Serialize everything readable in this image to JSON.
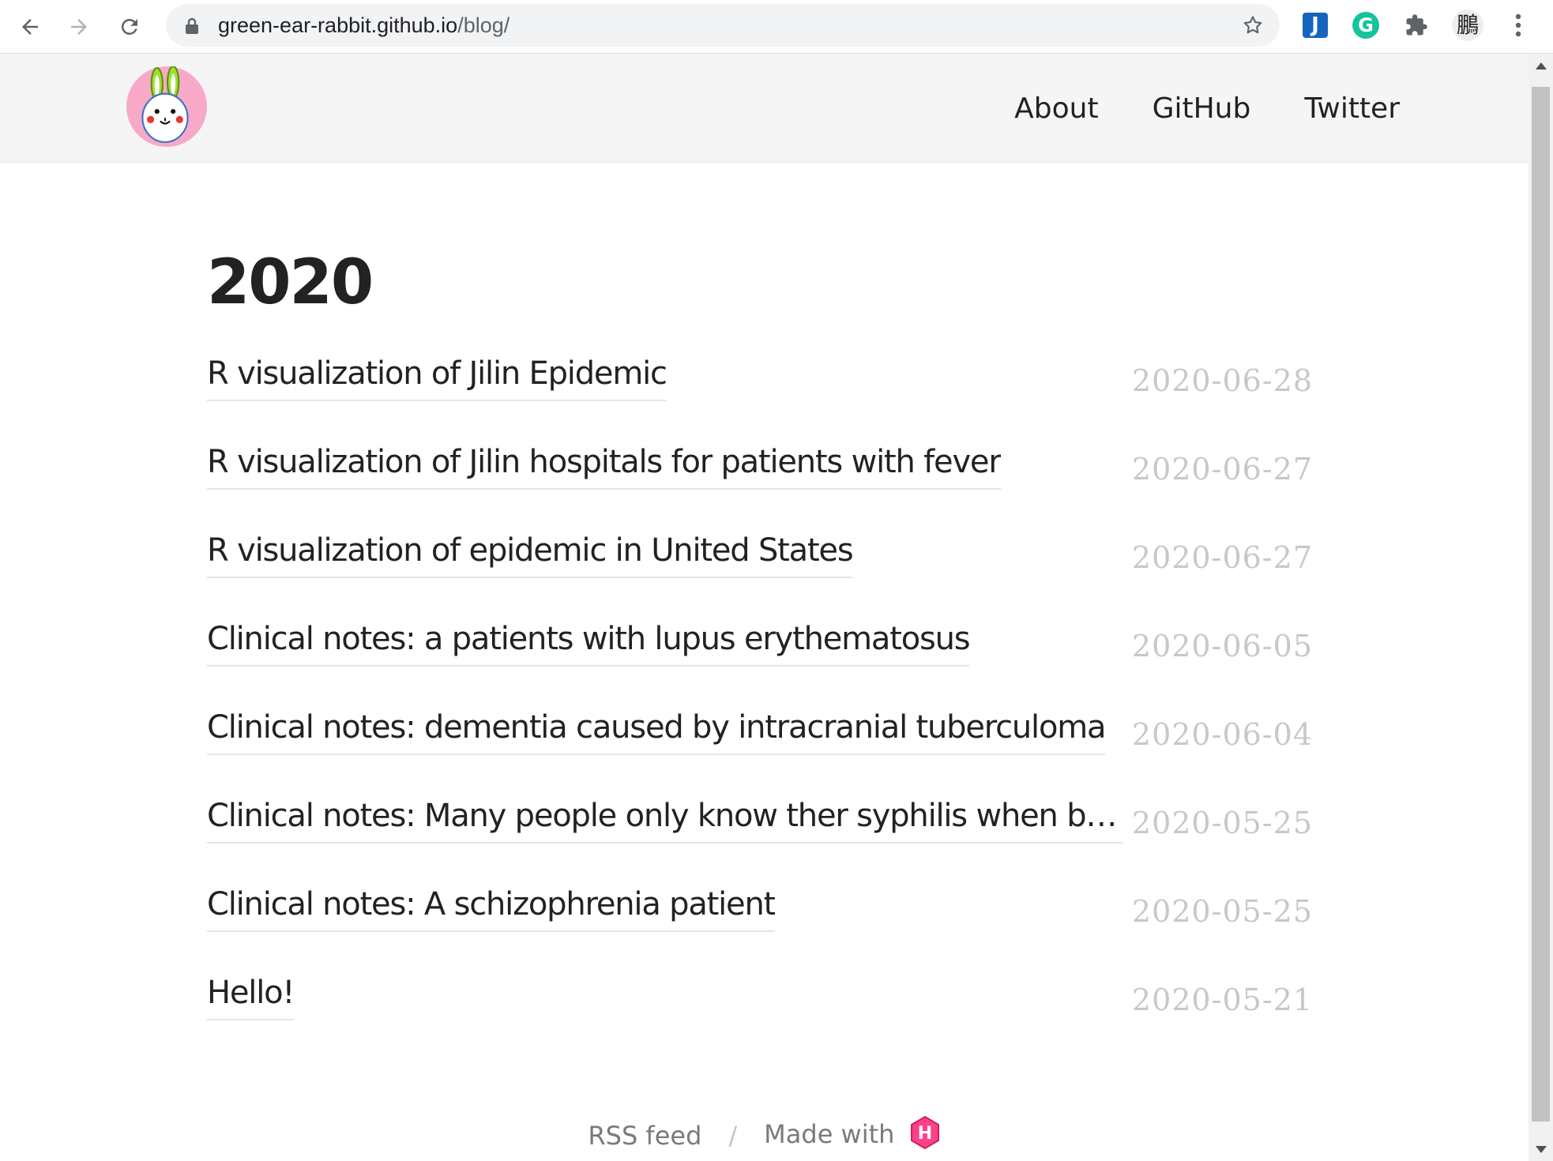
{
  "browser": {
    "url_host": "green-ear-rabbit.github.io",
    "url_path": "/blog/",
    "profile_initial": "鵬",
    "extensions": [
      {
        "name": "jira-extension",
        "glyph": "J",
        "color": "#1565c0"
      },
      {
        "name": "grammarly-extension",
        "glyph": "G",
        "color": "#15c39a"
      }
    ]
  },
  "header": {
    "nav": [
      {
        "label": "About"
      },
      {
        "label": "GitHub"
      },
      {
        "label": "Twitter"
      }
    ]
  },
  "main": {
    "year": "2020",
    "posts": [
      {
        "title": "R visualization of Jilin Epidemic",
        "date": "2020-06-28"
      },
      {
        "title": "R visualization of Jilin hospitals for patients with fever",
        "date": "2020-06-27"
      },
      {
        "title": "R visualization of epidemic in United States",
        "date": "2020-06-27"
      },
      {
        "title": "Clinical notes: a patients with lupus erythematosus",
        "date": "2020-06-05"
      },
      {
        "title": "Clinical notes: dementia caused by intracranial tuberculoma",
        "date": "2020-06-04"
      },
      {
        "title": "Clinical notes: Many people only know ther syphilis when bloo…",
        "date": "2020-05-25"
      },
      {
        "title": "Clinical notes: A schizophrenia patient",
        "date": "2020-05-25"
      },
      {
        "title": "Hello!",
        "date": "2020-05-21"
      }
    ]
  },
  "footer": {
    "rss_label": "RSS feed",
    "separator": "/",
    "made_with_label": "Made with",
    "hugo_glyph": "H"
  },
  "colors": {
    "header_bg": "#f5f5f5",
    "date_text": "#c8c8c8",
    "hugo_pink": "#ff4088"
  }
}
